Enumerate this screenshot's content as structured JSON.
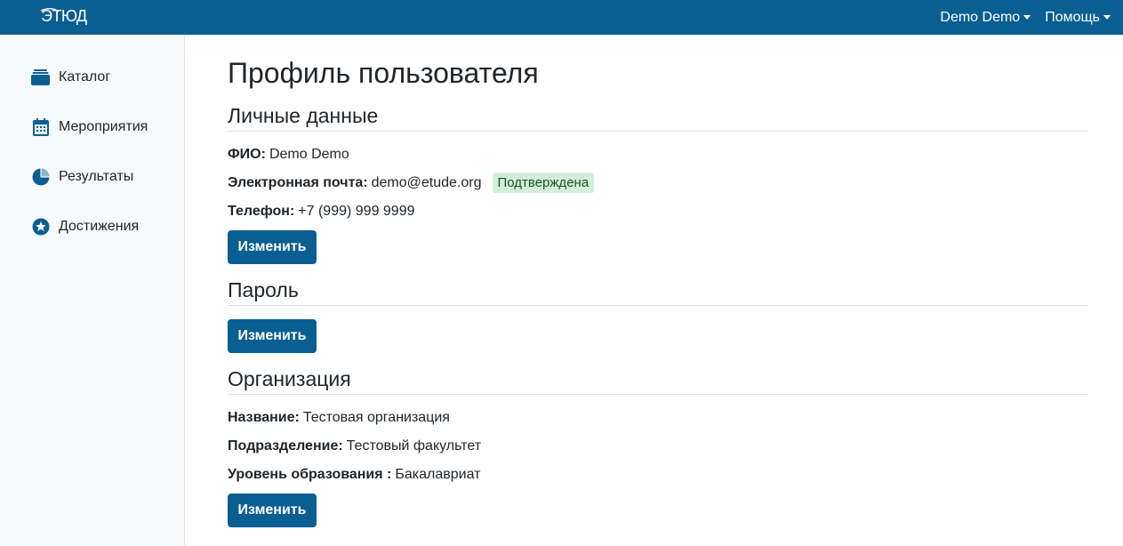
{
  "navbar": {
    "logo_text": "ЭТЮД",
    "user_menu_label": "Demo Demo",
    "help_menu_label": "Помощь"
  },
  "sidebar": {
    "items": [
      {
        "label": "Каталог",
        "icon": "inbox-icon"
      },
      {
        "label": "Мероприятия",
        "icon": "calendar-icon"
      },
      {
        "label": "Результаты",
        "icon": "pie-chart-icon"
      },
      {
        "label": "Достижения",
        "icon": "star-circle-icon"
      }
    ]
  },
  "main": {
    "page_title": "Профиль пользователя",
    "personal": {
      "title": "Личные данные",
      "fio_label": "ФИО:",
      "fio_value": "Demo Demo",
      "email_label": "Электронная почта:",
      "email_value": "demo@etude.org",
      "email_status": "Подтверждена",
      "phone_label": "Телефон:",
      "phone_value": "+7 (999) 999 9999",
      "edit_label": "Изменить"
    },
    "password": {
      "title": "Пароль",
      "edit_label": "Изменить"
    },
    "organization": {
      "title": "Организация",
      "name_label": "Название:",
      "name_value": "Тестовая организация",
      "division_label": "Подразделение:",
      "division_value": "Тестовый факультет",
      "level_label": "Уровень образования :",
      "level_value": "Бакалавриат",
      "edit_label": "Изменить"
    }
  },
  "colors": {
    "primary": "#0a5f92",
    "badge_bg": "#d4edda",
    "badge_text": "#155724",
    "sidebar_bg": "#f8f9fa"
  }
}
